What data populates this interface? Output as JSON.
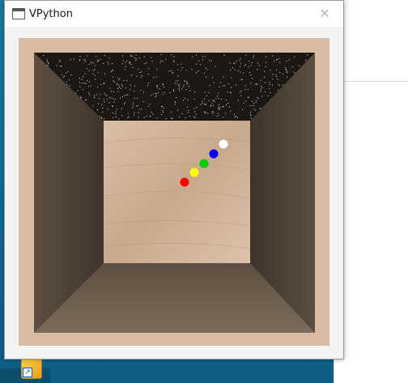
{
  "window": {
    "title": "VPython",
    "close_glyph": "✕",
    "icon": "window-icon"
  },
  "desktop": {
    "shortcut_icon": "python-shortcut-icon",
    "shortcut_arrow": "↗"
  },
  "scene": {
    "walls": "wood-texture",
    "ceiling": "starfield",
    "balls": [
      {
        "color": "#ff0000"
      },
      {
        "color": "#ffff00"
      },
      {
        "color": "#00cc00"
      },
      {
        "color": "#0000ff"
      },
      {
        "color": "#ffffff"
      }
    ]
  }
}
